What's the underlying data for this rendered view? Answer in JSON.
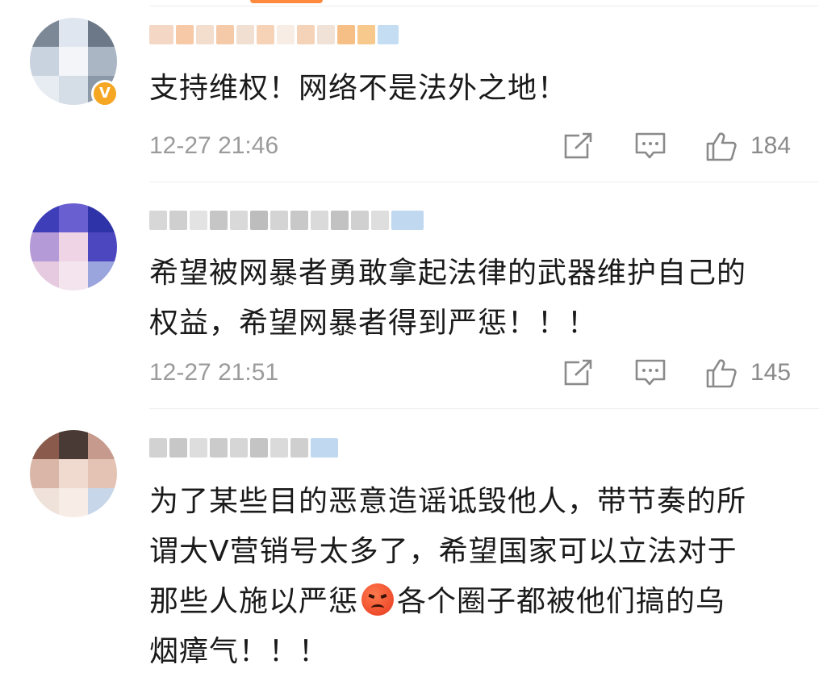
{
  "comments": [
    {
      "text": "支持维权！网络不是法外之地！",
      "time": "12-27 21:46",
      "likes": "184",
      "verified_badge": "V"
    },
    {
      "text_line1": "希望被网暴者勇敢拿起法律的武器维护自己的",
      "text_line2": "权益，希望网暴者得到严惩！！！",
      "time": "12-27 21:51",
      "likes": "145"
    },
    {
      "text_line1": "为了某些目的恶意造谣诋毁他人，带节奏的所",
      "text_line2": "谓大V营销号太多了，希望国家可以立法对于",
      "text_line3a": "那些人施以严惩",
      "text_line3b": "各个圈子都被他们搞的乌",
      "text_line4": "烟瘴气！！！"
    }
  ],
  "icons": {
    "share": "share-icon",
    "comment": "comment-icon",
    "like": "thumbs-up-icon",
    "emoji": "angry-face-emoji"
  },
  "colors": {
    "accent": "#ff8a3d",
    "verified": "#f5a623",
    "meta_text": "#9b9b9b",
    "body_text": "#1a1a1a",
    "divider": "#ececec"
  }
}
